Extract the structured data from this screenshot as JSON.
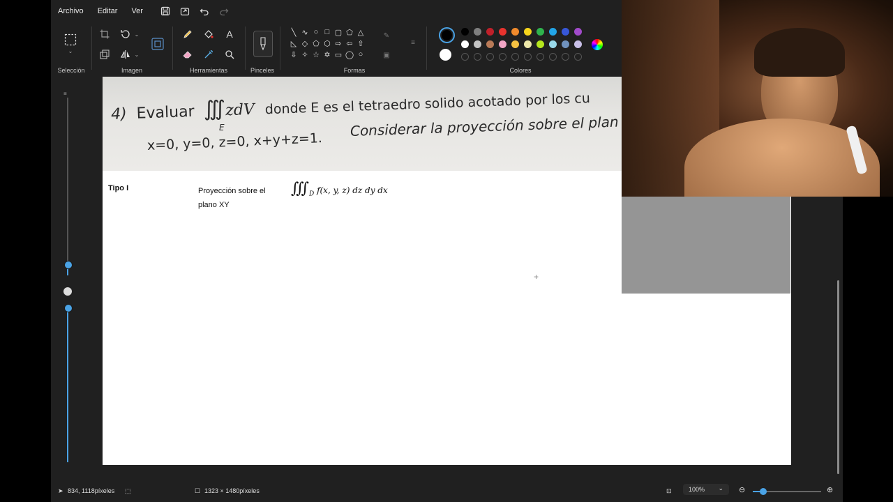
{
  "menu": {
    "items": [
      "Archivo",
      "Editar",
      "Ver"
    ],
    "icons": [
      "save-icon",
      "share-icon",
      "undo-icon",
      "redo-icon"
    ]
  },
  "ribbon": {
    "groups": {
      "selection": "Selección",
      "image": "Imagen",
      "tools": "Herramientas",
      "brushes": "Pinceles",
      "shapes": "Formas",
      "colors": "Colores"
    },
    "tool_glyph_text": "A",
    "palette_row1": [
      "#000000",
      "#7f7f7f",
      "#c0202a",
      "#e8332e",
      "#f08a2c",
      "#f7d51c",
      "#2fb34d",
      "#22a4e6",
      "#3757d8",
      "#a24bcb"
    ],
    "palette_row2": [
      "#ffffff",
      "#c3c3c3",
      "#b97a57",
      "#f2a5c5",
      "#f6c242",
      "#eee8aa",
      "#b5e61d",
      "#99d9ea",
      "#7092be",
      "#c8bfe7"
    ],
    "primary_color": "#000000",
    "secondary_color": "#ffffff"
  },
  "canvas": {
    "photo": {
      "line1_number": "4)",
      "line1_text": "Evaluar",
      "integral_text": "∭",
      "integral_sub": "E",
      "integrand": "zdV",
      "line1_rest": "donde E es el tetraedro solido acotado por los cu",
      "line2": "x=0, y=0, z=0, x+y+z=1.",
      "line2_italic": "Considerar  la proyección sobre el plan"
    },
    "table": {
      "type_label": "Tipo I",
      "projection_label": "Proyección sobre el plano XY",
      "formula_integral": "∭",
      "formula_sub": "D",
      "formula_body": "f(x, y, z) dz dy dx"
    }
  },
  "status": {
    "cursor_position": "834, 1118píxeles",
    "canvas_size": "1323 × 1480píxeles",
    "zoom": "100%",
    "zoom_fraction": 0.15
  }
}
